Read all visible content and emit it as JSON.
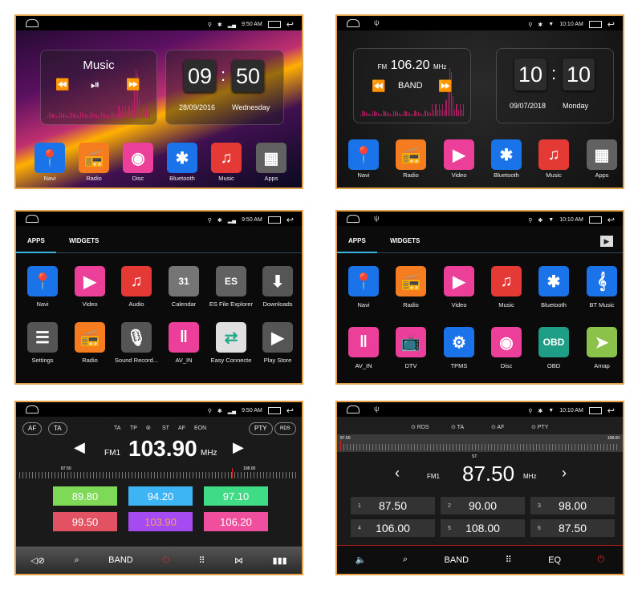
{
  "colors": {
    "frame": "#e3a24a",
    "tab_accent": "#3bb4e0",
    "power": "#e0282b"
  },
  "screens": [
    {
      "id": "home-1",
      "status": {
        "time": "9:50 AM",
        "usb": false,
        "icons": [
          "location-icon",
          "bluetooth-icon",
          "signal-icon"
        ]
      },
      "music_widget": {
        "title": "Music",
        "controls": [
          "⏪",
          "⏯",
          "⏩"
        ]
      },
      "clock": {
        "hour": "09",
        "minute": "50",
        "sep": ":",
        "date": "28/09/2016",
        "day": "Wednesday"
      },
      "apps": [
        {
          "label": "Navi",
          "icon": "navi-icon",
          "glyph": "📍",
          "color": "#1a73e8"
        },
        {
          "label": "Radio",
          "icon": "radio-icon",
          "glyph": "📻",
          "color": "#f57c1f"
        },
        {
          "label": "Disc",
          "icon": "disc-icon",
          "glyph": "◉",
          "color": "#ec3f9a"
        },
        {
          "label": "Bluetooth",
          "icon": "bluetooth-icon",
          "glyph": "✱",
          "color": "#1a73e8"
        },
        {
          "label": "Music",
          "icon": "music-icon",
          "glyph": "♫",
          "color": "#e53935"
        },
        {
          "label": "Apps",
          "icon": "apps-grid-icon",
          "glyph": "▦",
          "color": "#616161"
        }
      ]
    },
    {
      "id": "home-2",
      "status": {
        "time": "10:10 AM",
        "usb": true,
        "icons": [
          "location-icon",
          "bluetooth-icon",
          "wifi-icon"
        ]
      },
      "radio_widget": {
        "band": "FM",
        "freq": "106.20",
        "unit": "MHz",
        "center": "BAND"
      },
      "clock": {
        "hour": "10",
        "minute": "10",
        "sep": ":",
        "date": "09/07/2018",
        "day": "Monday"
      },
      "apps": [
        {
          "label": "Navi",
          "icon": "navi-icon",
          "glyph": "📍",
          "color": "#1a73e8"
        },
        {
          "label": "Radio",
          "icon": "radio-icon",
          "glyph": "📻",
          "color": "#f57c1f"
        },
        {
          "label": "Video",
          "icon": "video-icon",
          "glyph": "▶",
          "color": "#ec3f9a"
        },
        {
          "label": "Bluetooth",
          "icon": "bluetooth-icon",
          "glyph": "✱",
          "color": "#1a73e8"
        },
        {
          "label": "Music",
          "icon": "music-icon",
          "glyph": "♫",
          "color": "#e53935"
        },
        {
          "label": "Apps",
          "icon": "apps-grid-icon",
          "glyph": "▦",
          "color": "#616161"
        }
      ]
    },
    {
      "id": "apps-1",
      "status": {
        "time": "9:50 AM",
        "usb": false,
        "icons": [
          "location-icon",
          "bluetooth-icon",
          "signal-icon"
        ]
      },
      "tabs": [
        "APPS",
        "WIDGETS"
      ],
      "apps": [
        {
          "label": "Navi",
          "icon": "navi-icon",
          "glyph": "📍",
          "color": "#1a73e8"
        },
        {
          "label": "Video",
          "icon": "video-icon",
          "glyph": "▶",
          "color": "#ec3f9a"
        },
        {
          "label": "Audio",
          "icon": "audio-icon",
          "glyph": "♫",
          "color": "#e53935"
        },
        {
          "label": "Calendar",
          "icon": "calendar-icon",
          "glyph": "31",
          "color": "#757575"
        },
        {
          "label": "ES File Explorer",
          "icon": "es-file-explorer-icon",
          "glyph": "ES",
          "color": "#616161"
        },
        {
          "label": "Downloads",
          "icon": "downloads-icon",
          "glyph": "⬇",
          "color": "#555555"
        },
        {
          "label": "Settings",
          "icon": "settings-icon",
          "glyph": "☰",
          "color": "#555555"
        },
        {
          "label": "Radio",
          "icon": "radio-icon",
          "glyph": "📻",
          "color": "#f57c1f"
        },
        {
          "label": "Sound Record...",
          "icon": "sound-recorder-icon",
          "glyph": "🎙",
          "color": "#555555"
        },
        {
          "label": "AV_IN",
          "icon": "av-in-icon",
          "glyph": "ǁ",
          "color": "#ec3f9a"
        },
        {
          "label": "Easy Connecte",
          "icon": "easy-connect-icon",
          "glyph": "⇄",
          "color": "#e0e0e0"
        },
        {
          "label": "Play Store",
          "icon": "play-store-icon",
          "glyph": "▶",
          "color": "#555555"
        }
      ]
    },
    {
      "id": "apps-2",
      "status": {
        "time": "10:10 AM",
        "usb": true,
        "icons": [
          "location-icon",
          "bluetooth-icon",
          "wifi-icon"
        ]
      },
      "tabs": [
        "APPS",
        "WIDGETS"
      ],
      "apps": [
        {
          "label": "Navi",
          "icon": "navi-icon",
          "glyph": "📍",
          "color": "#1a73e8"
        },
        {
          "label": "Radio",
          "icon": "radio-icon",
          "glyph": "📻",
          "color": "#f57c1f"
        },
        {
          "label": "Video",
          "icon": "video-icon",
          "glyph": "▶",
          "color": "#ec3f9a"
        },
        {
          "label": "Music",
          "icon": "music-icon",
          "glyph": "♫",
          "color": "#e53935"
        },
        {
          "label": "Bluetooth",
          "icon": "bluetooth-icon",
          "glyph": "✱",
          "color": "#1a73e8"
        },
        {
          "label": "BT Music",
          "icon": "bt-music-icon",
          "glyph": "𝄞",
          "color": "#1a73e8"
        },
        {
          "label": "AV_IN",
          "icon": "av-in-icon",
          "glyph": "ǁ",
          "color": "#ec3f9a"
        },
        {
          "label": "DTV",
          "icon": "dtv-icon",
          "glyph": "📺",
          "color": "#ec3f9a"
        },
        {
          "label": "TPMS",
          "icon": "tpms-icon",
          "glyph": "⚙",
          "color": "#1a73e8"
        },
        {
          "label": "Disc",
          "icon": "disc-icon",
          "glyph": "◉",
          "color": "#ec3f9a"
        },
        {
          "label": "OBD",
          "icon": "obd-icon",
          "glyph": "OBD",
          "color": "#1e9e86"
        },
        {
          "label": "Amap",
          "icon": "amap-icon",
          "glyph": "➤",
          "color": "#8bc34a"
        }
      ]
    },
    {
      "id": "radio-1",
      "status": {
        "time": "9:50 AM",
        "usb": false,
        "icons": [
          "location-icon",
          "bluetooth-icon",
          "signal-icon"
        ]
      },
      "pills_left": [
        "AF",
        "TA"
      ],
      "pills_right": [
        "PTY",
        "RDS"
      ],
      "indicators": [
        "TA",
        "TP",
        "⦾",
        "ST",
        "AF",
        "EON"
      ],
      "band": "FM1",
      "freq": "103.90",
      "unit": "MHz",
      "scale_min": "87.50",
      "scale_max": "108.00",
      "presets": [
        {
          "value": "89.80",
          "color": "#7ed957"
        },
        {
          "value": "94.20",
          "color": "#3db5f5"
        },
        {
          "value": "97.10",
          "color": "#3fdc85"
        },
        {
          "value": "99.50",
          "color": "#e35262"
        },
        {
          "value": "103.90",
          "color": "#a64bf2",
          "active": true
        },
        {
          "value": "106.20",
          "color": "#ef4f9d"
        }
      ],
      "bottom_bar": [
        {
          "name": "mute-icon",
          "text": "◁⊘"
        },
        {
          "name": "search-icon",
          "text": "⌕"
        },
        {
          "name": "band-button",
          "text": "BAND"
        },
        {
          "name": "power-icon",
          "text": "⏻"
        },
        {
          "name": "keypad-icon",
          "text": "⠿"
        },
        {
          "name": "stereo-icon",
          "text": "⋈"
        },
        {
          "name": "equalizer-icon",
          "text": "▮▮▮"
        }
      ]
    },
    {
      "id": "radio-2",
      "status": {
        "time": "10:10 AM",
        "usb": true,
        "icons": [
          "location-icon",
          "bluetooth-icon",
          "wifi-icon"
        ]
      },
      "indicators": [
        "⊙ RDS",
        "⊙ TA",
        "⊙ AF",
        "⊙ PTY"
      ],
      "st": "ST",
      "band": "FM1",
      "freq": "87.50",
      "unit": "MHz",
      "scale_min": "87.50",
      "scale_max": "108.00",
      "presets": [
        {
          "n": "1",
          "value": "87.50"
        },
        {
          "n": "2",
          "value": "90.00"
        },
        {
          "n": "3",
          "value": "98.00"
        },
        {
          "n": "4",
          "value": "106.00"
        },
        {
          "n": "5",
          "value": "108.00"
        },
        {
          "n": "6",
          "value": "87.50"
        }
      ],
      "bottom_bar": [
        {
          "name": "volume-icon",
          "text": "🔈"
        },
        {
          "name": "search-icon",
          "text": "⌕"
        },
        {
          "name": "band-button",
          "text": "BAND"
        },
        {
          "name": "keypad-icon",
          "text": "⠿"
        },
        {
          "name": "eq-button",
          "text": "EQ"
        },
        {
          "name": "power-icon",
          "text": "⏻"
        }
      ]
    }
  ]
}
